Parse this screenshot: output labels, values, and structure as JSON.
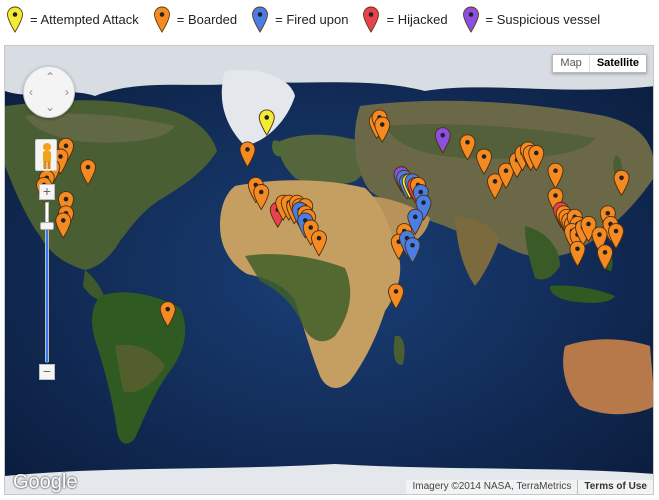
{
  "legend": [
    {
      "label": "= Attempted Attack",
      "color": "#f4eb37",
      "icon": "yellow-marker-icon"
    },
    {
      "label": "= Boarded",
      "color": "#f58a23",
      "icon": "orange-marker-icon"
    },
    {
      "label": "= Fired upon",
      "color": "#4a7ee6",
      "icon": "blue-marker-icon"
    },
    {
      "label": "= Hijacked",
      "color": "#e8424d",
      "icon": "red-marker-icon"
    },
    {
      "label": "= Suspicious vessel",
      "color": "#8c4fe0",
      "icon": "purple-marker-icon"
    }
  ],
  "map_type": {
    "map_label": "Map",
    "satellite_label": "Satellite",
    "selected": "Satellite"
  },
  "zoom": {
    "plus_label": "+",
    "minus_label": "−",
    "level": 0.85
  },
  "brand": "Google",
  "attribution": {
    "imagery": "Imagery ©2014 NASA, TerraMetrics",
    "terms": "Terms of Use"
  },
  "markers": [
    {
      "type": "attempted",
      "lon": -7,
      "lat": 31
    },
    {
      "type": "boarded",
      "lon": -14,
      "lat": 22
    },
    {
      "type": "boarded",
      "lon": -11,
      "lat": 12
    },
    {
      "type": "boarded",
      "lon": -9,
      "lat": 10
    },
    {
      "type": "hijacked",
      "lon": -3,
      "lat": 5
    },
    {
      "type": "boarded",
      "lon": -1,
      "lat": 7
    },
    {
      "type": "boarded",
      "lon": 1,
      "lat": 7
    },
    {
      "type": "boarded",
      "lon": 3,
      "lat": 6
    },
    {
      "type": "boarded",
      "lon": 4,
      "lat": 7
    },
    {
      "type": "boarded",
      "lon": 5,
      "lat": 6
    },
    {
      "type": "boarded",
      "lon": 6,
      "lat": 5
    },
    {
      "type": "boarded",
      "lon": 7,
      "lat": 6
    },
    {
      "type": "fired",
      "lon": 5,
      "lat": 5
    },
    {
      "type": "boarded",
      "lon": 7,
      "lat": 4
    },
    {
      "type": "boarded",
      "lon": 8,
      "lat": 3
    },
    {
      "type": "fired",
      "lon": 7,
      "lat": 2
    },
    {
      "type": "boarded",
      "lon": 9,
      "lat": 0
    },
    {
      "type": "boarded",
      "lon": 12,
      "lat": -3
    },
    {
      "type": "boarded",
      "lon": 33,
      "lat": 30
    },
    {
      "type": "boarded",
      "lon": 34,
      "lat": 31
    },
    {
      "type": "boarded",
      "lon": 35,
      "lat": 29
    },
    {
      "type": "suspicious",
      "lon": 42,
      "lat": 15
    },
    {
      "type": "fired",
      "lon": 43,
      "lat": 14
    },
    {
      "type": "fired",
      "lon": 44,
      "lat": 13
    },
    {
      "type": "attempted",
      "lon": 45,
      "lat": 13
    },
    {
      "type": "fired",
      "lon": 46,
      "lat": 13
    },
    {
      "type": "hijacked",
      "lon": 47,
      "lat": 12
    },
    {
      "type": "boarded",
      "lon": 48,
      "lat": 12
    },
    {
      "type": "fired",
      "lon": 49,
      "lat": 10
    },
    {
      "type": "fired",
      "lon": 50,
      "lat": 7
    },
    {
      "type": "fired",
      "lon": 47,
      "lat": 3
    },
    {
      "type": "boarded",
      "lon": 43,
      "lat": -1
    },
    {
      "type": "boarded",
      "lon": 41,
      "lat": -4
    },
    {
      "type": "fired",
      "lon": 44,
      "lat": -3
    },
    {
      "type": "fired",
      "lon": 46,
      "lat": -5
    },
    {
      "type": "boarded",
      "lon": 40,
      "lat": -18
    },
    {
      "type": "suspicious",
      "lon": 57,
      "lat": 26
    },
    {
      "type": "boarded",
      "lon": 66,
      "lat": 24
    },
    {
      "type": "boarded",
      "lon": 72,
      "lat": 20
    },
    {
      "type": "boarded",
      "lon": 76,
      "lat": 13
    },
    {
      "type": "boarded",
      "lon": 80,
      "lat": 16
    },
    {
      "type": "boarded",
      "lon": 84,
      "lat": 19
    },
    {
      "type": "boarded",
      "lon": 86,
      "lat": 21
    },
    {
      "type": "boarded",
      "lon": 88,
      "lat": 22
    },
    {
      "type": "boarded",
      "lon": 89,
      "lat": 21
    },
    {
      "type": "boarded",
      "lon": 91,
      "lat": 21
    },
    {
      "type": "boarded",
      "lon": 98,
      "lat": 16
    },
    {
      "type": "boarded",
      "lon": 98,
      "lat": 9
    },
    {
      "type": "hijacked",
      "lon": 100,
      "lat": 5
    },
    {
      "type": "boarded",
      "lon": 101,
      "lat": 4
    },
    {
      "type": "boarded",
      "lon": 102,
      "lat": 3
    },
    {
      "type": "boarded",
      "lon": 103,
      "lat": 2
    },
    {
      "type": "boarded",
      "lon": 104,
      "lat": 1
    },
    {
      "type": "boarded",
      "lon": 105,
      "lat": 3
    },
    {
      "type": "boarded",
      "lon": 106,
      "lat": 1
    },
    {
      "type": "boarded",
      "lon": 104,
      "lat": -1
    },
    {
      "type": "boarded",
      "lon": 106,
      "lat": -2
    },
    {
      "type": "boarded",
      "lon": 108,
      "lat": 0
    },
    {
      "type": "boarded",
      "lon": 110,
      "lat": 1
    },
    {
      "type": "boarded",
      "lon": 117,
      "lat": 4
    },
    {
      "type": "boarded",
      "lon": 118,
      "lat": 1
    },
    {
      "type": "boarded",
      "lon": 114,
      "lat": -2
    },
    {
      "type": "boarded",
      "lon": 106,
      "lat": -6
    },
    {
      "type": "boarded",
      "lon": 116,
      "lat": -7
    },
    {
      "type": "boarded",
      "lon": 122,
      "lat": 14
    },
    {
      "type": "boarded",
      "lon": 120,
      "lat": -1
    },
    {
      "type": "boarded",
      "lon": -80,
      "lat": 23
    },
    {
      "type": "boarded",
      "lon": -82,
      "lat": 20
    },
    {
      "type": "boarded",
      "lon": -85,
      "lat": 17
    },
    {
      "type": "boarded",
      "lon": -87,
      "lat": 14
    },
    {
      "type": "boarded",
      "lon": -88,
      "lat": 12
    },
    {
      "type": "boarded",
      "lon": -72,
      "lat": 17
    },
    {
      "type": "boarded",
      "lon": -80,
      "lat": 8
    },
    {
      "type": "boarded",
      "lon": -80,
      "lat": 4
    },
    {
      "type": "boarded",
      "lon": -81,
      "lat": 2
    },
    {
      "type": "boarded",
      "lon": -43,
      "lat": -23
    }
  ]
}
